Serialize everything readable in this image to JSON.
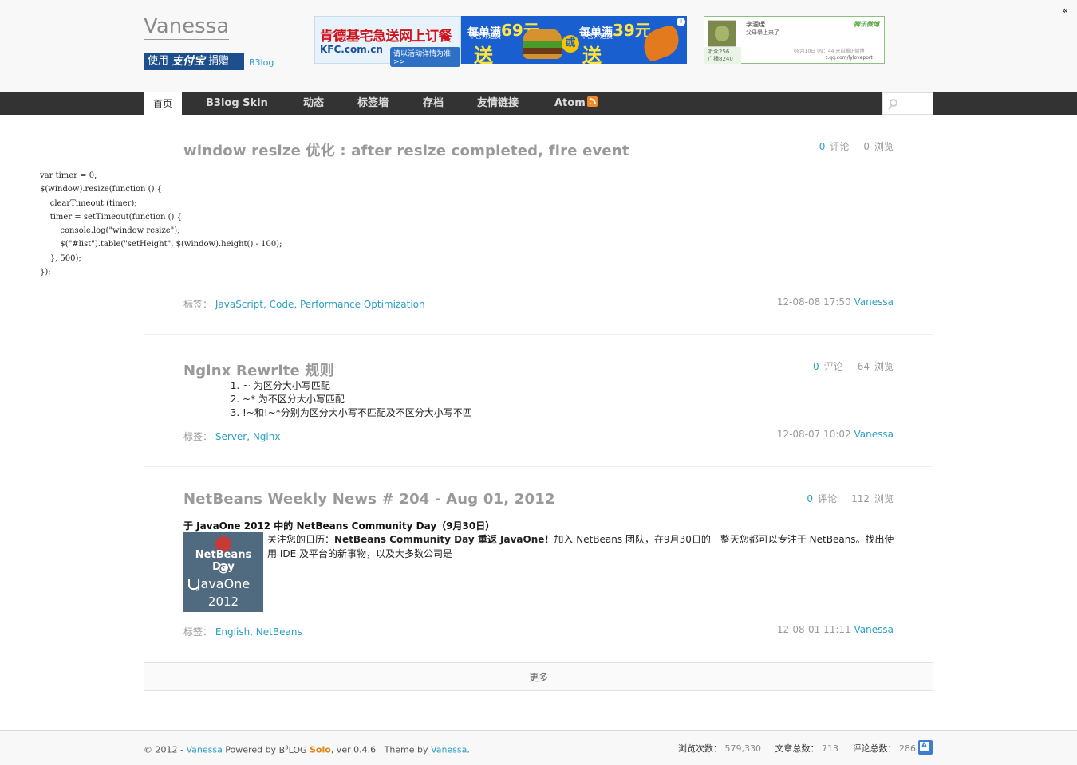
{
  "header": {
    "site_title": "Vanessa",
    "alipay": {
      "use": "使用",
      "brand": "支付宝",
      "donate": "捐赠"
    },
    "b3log_link": "B3log",
    "kfc_ad": {
      "brand_cn": "肯德基宅急送网上订餐",
      "url": "KFC.com.cn",
      "note": "请以活动详情为准>>",
      "deal1": "每单满",
      "deal1_amount": "69元",
      "deal2": "每单满",
      "deal2_amount": "39元",
      "sub": "不含外送费",
      "song": "送",
      "or": "或"
    },
    "weibo": {
      "name": "李涸瑷",
      "status": "父母晕上来了",
      "logo": "腾讯微博",
      "fans": "听众256",
      "broadcast": "广播8240",
      "time": "08月10日 09：44 来自腾讯微博",
      "url": "t.qq.com/lyloveport"
    }
  },
  "nav": {
    "items": [
      {
        "label": "首页",
        "active": true
      },
      {
        "label": "B3log Skin"
      },
      {
        "label": "动态"
      },
      {
        "label": "标签墙"
      },
      {
        "label": "存档"
      },
      {
        "label": "友情链接"
      },
      {
        "label": "Atom"
      }
    ],
    "search_placeholder": ""
  },
  "labels": {
    "comments": "评论",
    "views": "浏览",
    "tags_prefix": "标签："
  },
  "articles": [
    {
      "title": "window resize 优化 : after resize completed, fire event",
      "comments": "0",
      "views": "0",
      "code": "var timer = 0;\n$(window).resize(function () {\n    clearTimeout (timer);\n    timer = setTimeout(function () {\n        console.log(\"window resize\");\n        $(\"#list\").table(\"setHeight\", $(window).height() - 100);\n    }, 500);\n});",
      "tags": "JavaScript, Code, Performance Optimization",
      "date": "12-08-08 17:50",
      "author": "Vanessa"
    },
    {
      "title": "Nginx Rewrite 规则",
      "comments": "0",
      "views": "64",
      "rules": [
        "~ 为区分大小写匹配",
        "~* 为不区分大小写匹配",
        "!~和!~*分别为区分大小写不匹配及不区分大小写不匹"
      ],
      "tags": "Server, Nginx",
      "date": "12-08-07 10:02",
      "author": "Vanessa"
    },
    {
      "title": "NetBeans Weekly News # 204 - Aug 01, 2012",
      "comments": "0",
      "views": "112",
      "heading": "于 JavaOne 2012 中的 NetBeans Community Day（9月30日）",
      "desc_prefix": "关注您的日历：",
      "desc_bold": "NetBeans Community Day 重返 JavaOne！",
      "desc_rest": "加入 NetBeans 团队，在9月30日的一整天您都可以专注于 NetBeans。找出使用 IDE 及平台的新事物，以及大多数公司是",
      "image": {
        "line1": "NetBeans Day",
        "line2": "@",
        "line3": "JavaOne",
        "line4": "2012"
      },
      "tags": "English, NetBeans",
      "date": "12-08-01 11:11",
      "author": "Vanessa"
    }
  ],
  "more_button": "更多",
  "footer": {
    "copyright": "© 2012 - ",
    "author_link": "Vanessa",
    "powered_by": " Powered by ",
    "b3": "B",
    "b3_sup": "3",
    "log": "LOG",
    "solo": "Solo",
    "version": ", ver 0.4.6",
    "theme_by": "Theme by ",
    "theme_author": "Vanessa",
    "stats": [
      {
        "label": "浏览次数：",
        "value": "579,330"
      },
      {
        "label": "文章总数：",
        "value": "713"
      },
      {
        "label": "评论总数：",
        "value": "286"
      }
    ]
  }
}
